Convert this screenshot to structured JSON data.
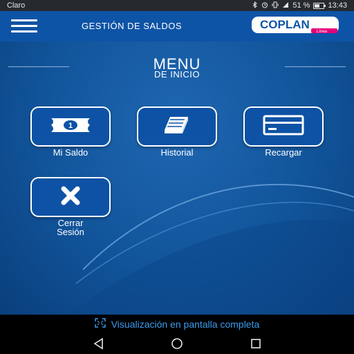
{
  "status": {
    "carrier": "Claro",
    "battery_pct": "51 %",
    "battery_level": 0.51,
    "time": "13:43",
    "icons": [
      "bluetooth-icon",
      "alarm-icon",
      "vibrate-icon",
      "signal-icon",
      "battery-icon"
    ]
  },
  "appbar": {
    "title": "GESTIÓN DE SALDOS",
    "logo_text": "COPLAN",
    "logo_sub": "Línea"
  },
  "menu": {
    "title": "MENU",
    "subtitle": "DE INICIO",
    "items": [
      {
        "label": "Mi Saldo",
        "icon": "banknote-icon"
      },
      {
        "label": "Historial",
        "icon": "book-icon"
      },
      {
        "label": "Recargar",
        "icon": "credit-card-icon"
      },
      {
        "label_line1": "Cerrar",
        "label_line2": "Sesión",
        "icon": "close-icon"
      }
    ]
  },
  "fullscreen": {
    "label": "Visualización en pantalla completa",
    "icon": "fullscreen-icon"
  },
  "colors": {
    "appbar": "#0d54a6",
    "tile": "#0e52a5",
    "link": "#3b9cf0",
    "logo_accent": "#e4007c"
  }
}
